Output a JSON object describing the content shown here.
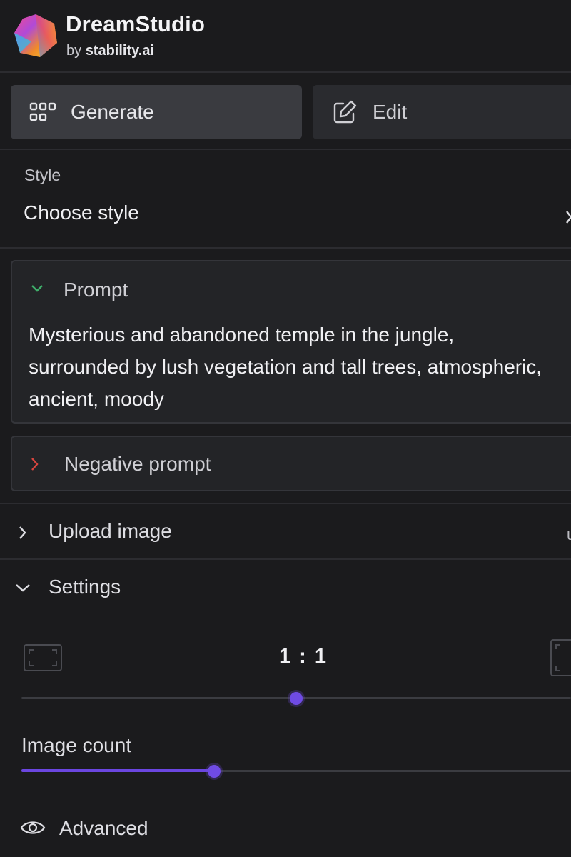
{
  "brand": {
    "name": "DreamStudio",
    "by_prefix": "by",
    "by_name": "stability.ai"
  },
  "modes": {
    "generate_label": "Generate",
    "edit_label": "Edit",
    "active": "Generate"
  },
  "style": {
    "caption": "Style",
    "value": "Choose style"
  },
  "prompt": {
    "title": "Prompt",
    "text": "Mysterious and abandoned temple in the jungle, surrounded by lush vegetation and tall trees, atmospheric, ancient, moody",
    "expanded": true
  },
  "negative_prompt": {
    "title": "Negative prompt",
    "expanded": false
  },
  "upload_image": {
    "label": "Upload image",
    "trailing_text": "u"
  },
  "settings": {
    "label": "Settings",
    "expanded": true,
    "aspect_ratio": {
      "value": "1 : 1",
      "slider_fraction": 0.5
    },
    "image_count": {
      "label": "Image count",
      "slider_fraction": 0.35
    },
    "advanced_label": "Advanced"
  },
  "colors": {
    "background": "#1b1b1d",
    "accent": "#6b46e0",
    "prompt_chevron": "#3fae6a",
    "negative_chevron": "#d9463f"
  },
  "icons": {
    "logo": "dreamstudio-hexagon-logo",
    "generate": "grid-icon",
    "edit": "edit-pencil-icon",
    "style_chevron": "chevron-right-icon",
    "prompt_chevron": "chevron-down-icon",
    "negative_chevron": "chevron-right-icon",
    "upload_chevron": "chevron-right-icon",
    "settings_chevron": "chevron-down-icon",
    "aspect_landscape": "aspect-landscape-icon",
    "aspect_portrait": "aspect-portrait-icon",
    "advanced": "eye-icon"
  }
}
